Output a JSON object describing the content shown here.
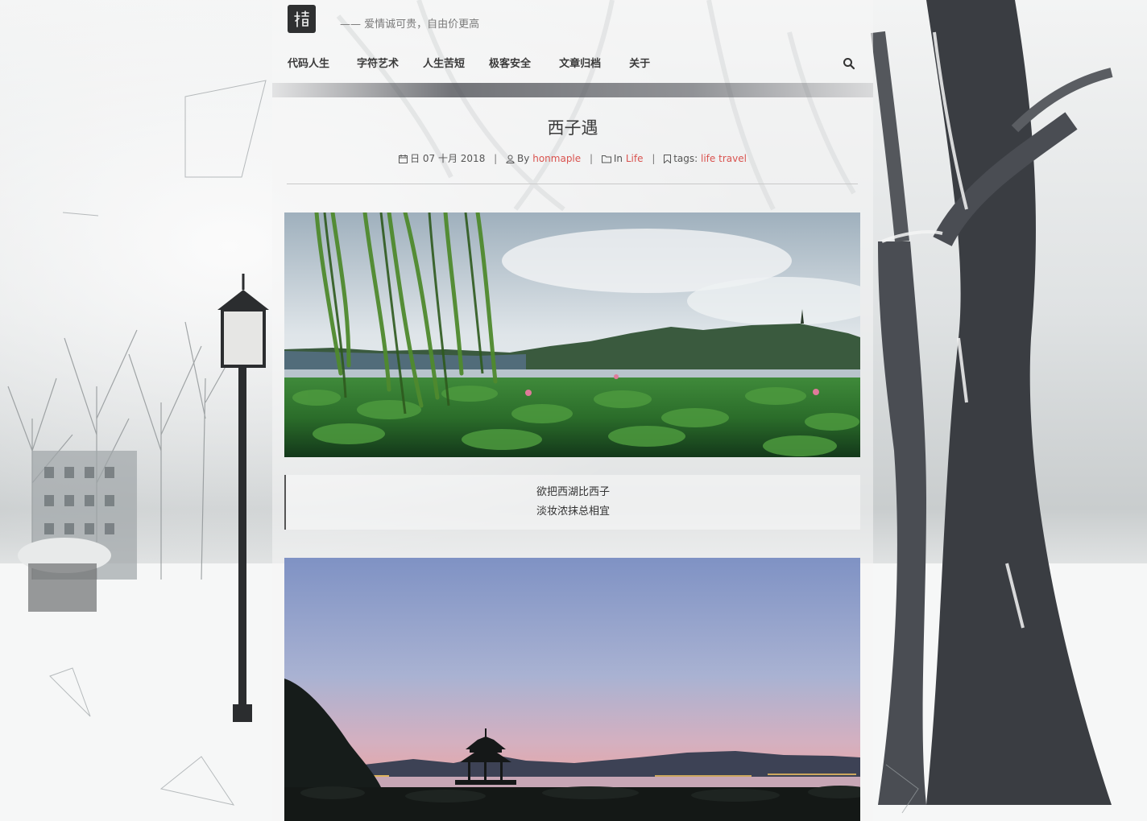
{
  "header": {
    "slogan": "—— 爱情诚可贵，自由价更高"
  },
  "nav": {
    "items": [
      {
        "label": "代码人生"
      },
      {
        "label": "字符艺术"
      },
      {
        "label": "人生苦短"
      },
      {
        "label": "极客安全"
      },
      {
        "label": "文章归档"
      },
      {
        "label": "关于"
      }
    ],
    "search_icon": "search-icon"
  },
  "post": {
    "title": "西子遇",
    "meta": {
      "date": "日 07 十月 2018",
      "by_label": "By",
      "author": "honmaple",
      "in_label": "In",
      "category": "Life",
      "tags_label": "tags:",
      "tags": [
        "life",
        "travel"
      ],
      "separator": "|"
    },
    "quote": {
      "line1": "欲把西湖比西子",
      "line2": "淡妆浓抹总相宜"
    }
  },
  "colors": {
    "link": "#d9534f",
    "text": "#3b3b3b",
    "logo_bg": "#2f3031"
  }
}
